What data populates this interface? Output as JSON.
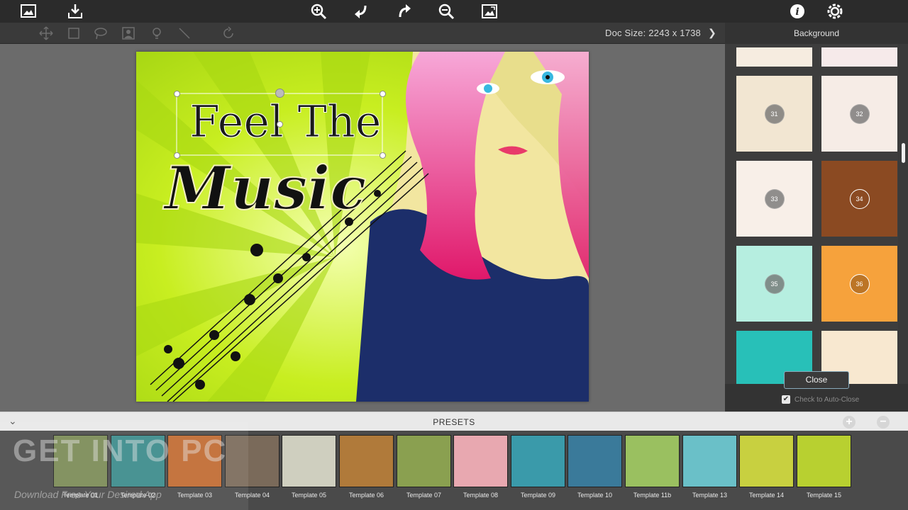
{
  "toolbar": {
    "doc_size": "Doc Size: 2243 x 1738"
  },
  "panel": {
    "title": "Background",
    "swatches": [
      {
        "num": "31",
        "color": "#f2e6d2"
      },
      {
        "num": "32",
        "color": "#f6ece6"
      },
      {
        "num": "33",
        "color": "#f8efe8"
      },
      {
        "num": "34",
        "color": "#8b4a22"
      },
      {
        "num": "35",
        "color": "#b6eee0"
      },
      {
        "num": "36",
        "color": "#f6a23c"
      }
    ],
    "close_label": "Close",
    "auto_close_label": "Check to Auto-Close",
    "auto_close_checked": "✔"
  },
  "presets": {
    "label": "PRESETS",
    "collapse_icon": "⌄",
    "add_icon": "+",
    "remove_icon": "−",
    "templates": [
      {
        "label": "Template 01",
        "color": "#7a8a55"
      },
      {
        "label": "Template 02",
        "color": "#3a8a8a"
      },
      {
        "label": "Template 03",
        "color": "#c06a30"
      },
      {
        "label": "Template 04",
        "color": "#7a6a5a"
      },
      {
        "label": "Template 05",
        "color": "#cfcfbf"
      },
      {
        "label": "Template 06",
        "color": "#b07a3a"
      },
      {
        "label": "Template 07",
        "color": "#8aa050"
      },
      {
        "label": "Template 08",
        "color": "#e8a8b0"
      },
      {
        "label": "Template 09",
        "color": "#3a9aaa"
      },
      {
        "label": "Template 10",
        "color": "#3a7a9a"
      },
      {
        "label": "Template 11b",
        "color": "#9ac060"
      },
      {
        "label": "Template 13",
        "color": "#6ac0c8"
      },
      {
        "label": "Template 14",
        "color": "#c8d040"
      },
      {
        "label": "Template 15",
        "color": "#b8d030"
      }
    ]
  },
  "canvas": {
    "headline_1": "Feel The",
    "headline_2": "Music"
  },
  "watermark": {
    "main": "GET INTO PC",
    "sub": "Download Free Your Desired App"
  }
}
